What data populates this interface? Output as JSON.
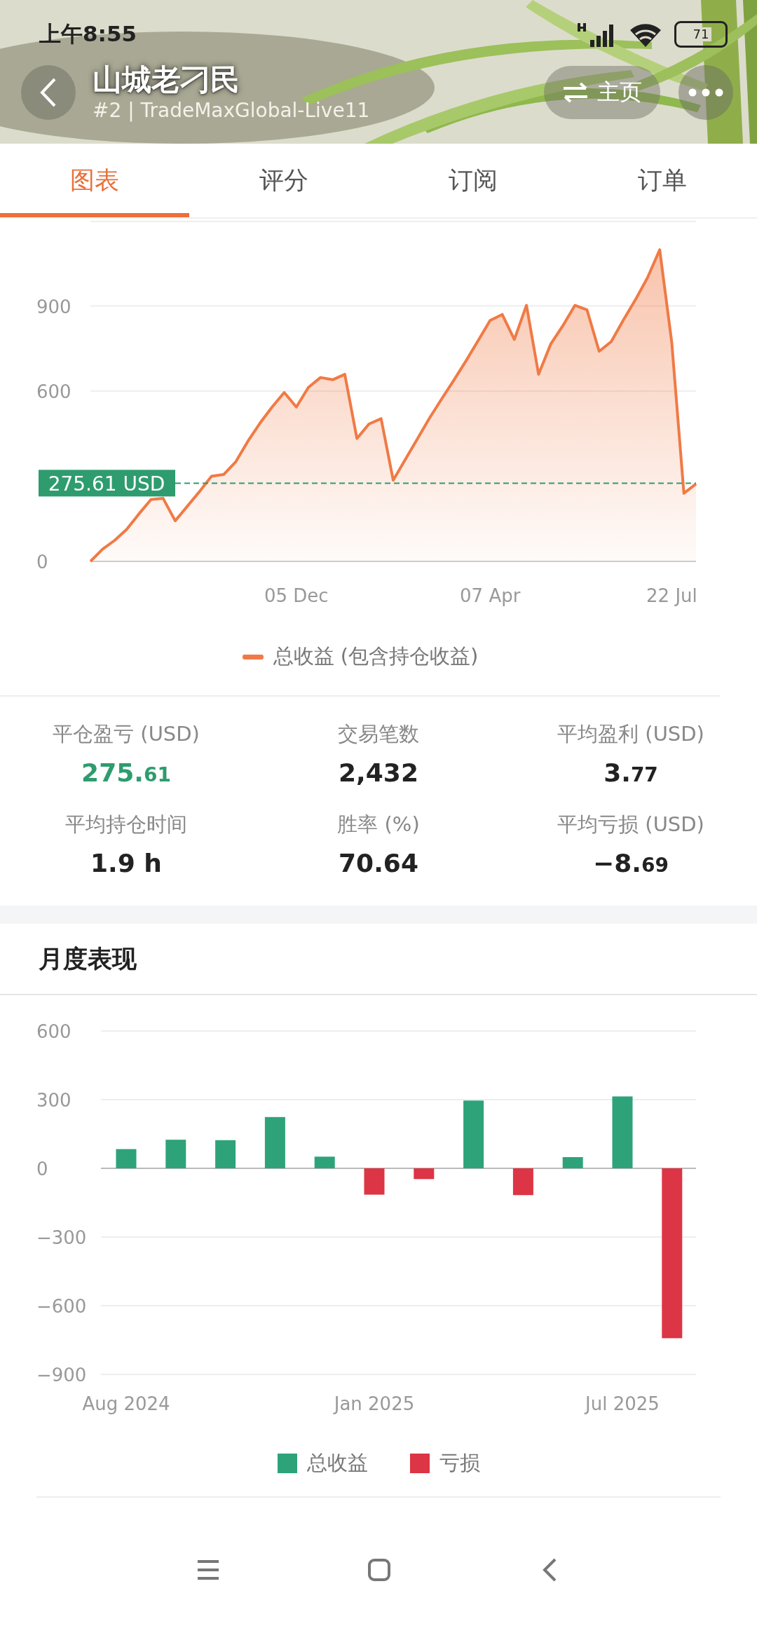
{
  "status_bar": {
    "time": "上午8:55",
    "battery": "71"
  },
  "header": {
    "title": "山城老刁民",
    "subtitle": "#2 | TradeMaxGlobal-Live11",
    "home_button": "主页"
  },
  "tabs": [
    {
      "label": "图表",
      "selected": true
    },
    {
      "label": "评分",
      "selected": false
    },
    {
      "label": "订阅",
      "selected": false
    },
    {
      "label": "订单",
      "selected": false
    }
  ],
  "equity_chart": {
    "chart_data": {
      "type": "area",
      "series": [
        {
          "name": "总收益 (包含持仓收益)",
          "color": "#f07a45",
          "values": [
            0,
            43,
            74,
            113,
            167,
            218,
            222,
            143,
            194,
            246,
            300,
            306,
            351,
            423,
            487,
            544,
            595,
            544,
            613,
            648,
            640,
            659,
            433,
            484,
            503,
            286,
            359,
            432,
            505,
            572,
            638,
            706,
            777,
            849,
            870,
            782,
            902,
            659,
            765,
            830,
            902,
            886,
            740,
            774,
            850,
            922,
            1000,
            1098,
            771,
            240,
            273
          ]
        }
      ],
      "categories": [
        null,
        null,
        null,
        null,
        null,
        null,
        null,
        null,
        null,
        null,
        null,
        null,
        null,
        null,
        null,
        null,
        null,
        "05 Dec",
        null,
        null,
        null,
        null,
        null,
        null,
        null,
        null,
        null,
        null,
        null,
        null,
        null,
        null,
        null,
        "07 Apr",
        null,
        null,
        null,
        null,
        null,
        null,
        null,
        null,
        null,
        null,
        null,
        null,
        null,
        null,
        "22 Jul",
        null,
        null
      ],
      "ylim": [
        0,
        1200
      ],
      "yticks": [
        0,
        600,
        900
      ],
      "grid": true,
      "legend": "bottom",
      "ref_lines": [
        {
          "axis": "y",
          "value": 275.61,
          "label": "275.61 USD",
          "color": "#2e9c6e"
        }
      ]
    }
  },
  "stats": [
    {
      "label": "平仓盈亏 (USD)",
      "value": "275.61",
      "small_decimals": true,
      "highlight": true
    },
    {
      "label": "交易笔数",
      "value": "2,432",
      "highlight": false
    },
    {
      "label": "平均盈利 (USD)",
      "value": "3.77",
      "small_decimals": true,
      "highlight": false
    },
    {
      "label": "平均持仓时间",
      "value": "1.9 h",
      "highlight": false
    },
    {
      "label": "胜率 (%)",
      "value": "70.64",
      "highlight": false
    },
    {
      "label": "平均亏损 (USD)",
      "value": "−8.69",
      "small_decimals": true,
      "highlight": false
    }
  ],
  "monthly": {
    "title": "月度表现",
    "chart_data": {
      "type": "bar",
      "categories": [
        "Aug 2024",
        null,
        null,
        null,
        null,
        "Jan 2025",
        null,
        null,
        null,
        null,
        "Jul 2025",
        null
      ],
      "series": [
        {
          "name": "总收益",
          "color": "#2ea37a",
          "values": [
            84,
            125,
            123,
            224,
            51,
            null,
            null,
            296,
            null,
            49,
            314,
            null
          ]
        },
        {
          "name": "亏损",
          "color": "#dc3545",
          "values": [
            null,
            null,
            null,
            null,
            null,
            -115,
            -47,
            null,
            -117,
            null,
            null,
            -742
          ]
        }
      ],
      "ylim": [
        -900,
        600
      ],
      "yticks": [
        -900,
        -600,
        -300,
        0,
        300,
        600
      ],
      "stacked": true,
      "grid": true,
      "legend": "bottom"
    }
  }
}
